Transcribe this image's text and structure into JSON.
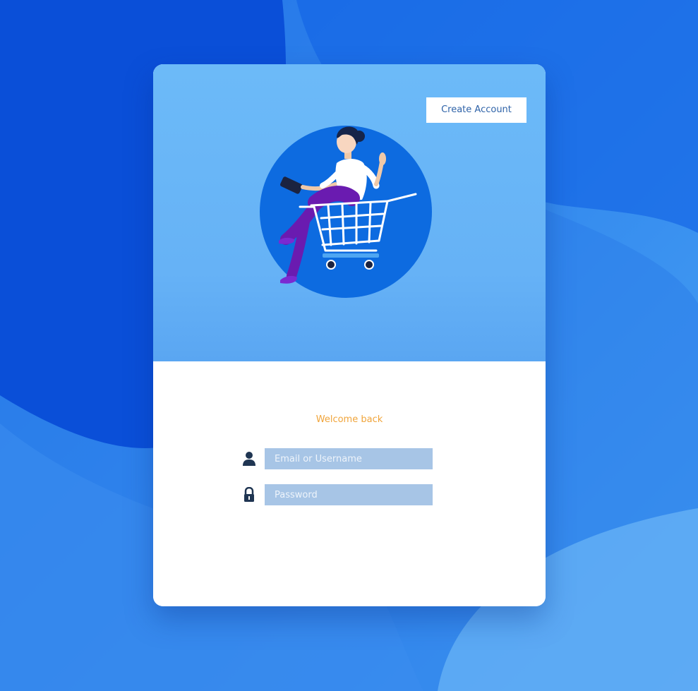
{
  "header": {
    "create_account_label": "Create Account"
  },
  "hero": {
    "illustration": "woman-in-shopping-cart-illustration"
  },
  "login": {
    "welcome_text": "Welcome back",
    "email": {
      "value": "",
      "placeholder": "Email or Username",
      "icon": "user-icon"
    },
    "password": {
      "value": "",
      "placeholder": "Password",
      "icon": "lock-icon"
    }
  },
  "colors": {
    "accent": "#f0a43a",
    "header_bg": "#6cbaf8",
    "input_bg": "#a7c5e6",
    "icon": "#1f3552",
    "button_text": "#2f63a8"
  }
}
